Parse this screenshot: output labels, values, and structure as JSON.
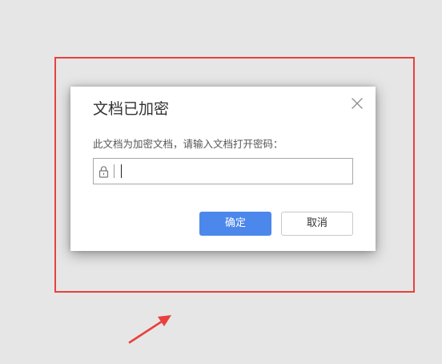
{
  "dialog": {
    "title": "文档已加密",
    "prompt": "此文档为加密文档，请输入文档打开密码：",
    "password": {
      "value": "",
      "placeholder": ""
    },
    "buttons": {
      "ok_label": "确定",
      "cancel_label": "取消"
    }
  },
  "icons": {
    "close": "close-icon",
    "lock": "lock-icon"
  },
  "colors": {
    "background": "#e7e6e6",
    "annotation_red": "#e8413e",
    "primary_button": "#4c87ec",
    "dialog_background": "#ffffff"
  }
}
